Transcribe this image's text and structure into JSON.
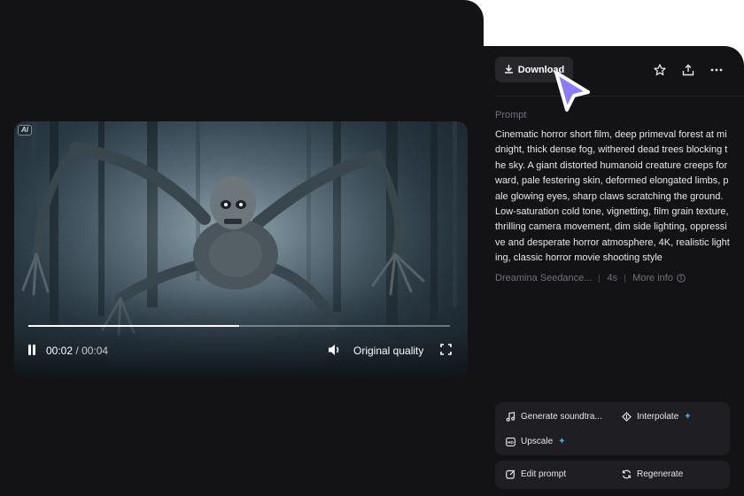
{
  "video": {
    "ai_badge": "AI",
    "progress": 0.5,
    "current_time": "00:02",
    "separator": "/",
    "duration": "00:04",
    "quality": "Original quality"
  },
  "toolbar": {
    "download_label": "Download",
    "icons": [
      "download-icon",
      "star-icon",
      "share-icon",
      "more-icon"
    ]
  },
  "prompt": {
    "label": "Prompt",
    "text": "Cinematic horror short film, deep primeval forest at midnight, thick dense fog, withered dead trees blocking the sky. A giant distorted humanoid creature creeps forward, pale festering skin, deformed elongated limbs, pale glowing eyes, sharp claws scratching the ground. Low-saturation cold tone, vignetting, film grain texture, thrilling camera movement, dim side lighting, oppressive and desperate horror atmosphere, 4K, realistic lighting, classic horror movie shooting style"
  },
  "meta": {
    "model": "Dreamina Seedance...",
    "length": "4s",
    "more_info": "More info"
  },
  "actions": {
    "generate_soundtrack": "Generate soundtra...",
    "interpolate": "Interpolate",
    "upscale": "Upscale",
    "edit_prompt": "Edit prompt",
    "regenerate": "Regenerate",
    "sparkle": "✦"
  },
  "colors": {
    "panel_bg": "#131316",
    "card_bg": "#1f1f23",
    "accent": "#29b7ff",
    "cursor": "#8b7cff"
  }
}
